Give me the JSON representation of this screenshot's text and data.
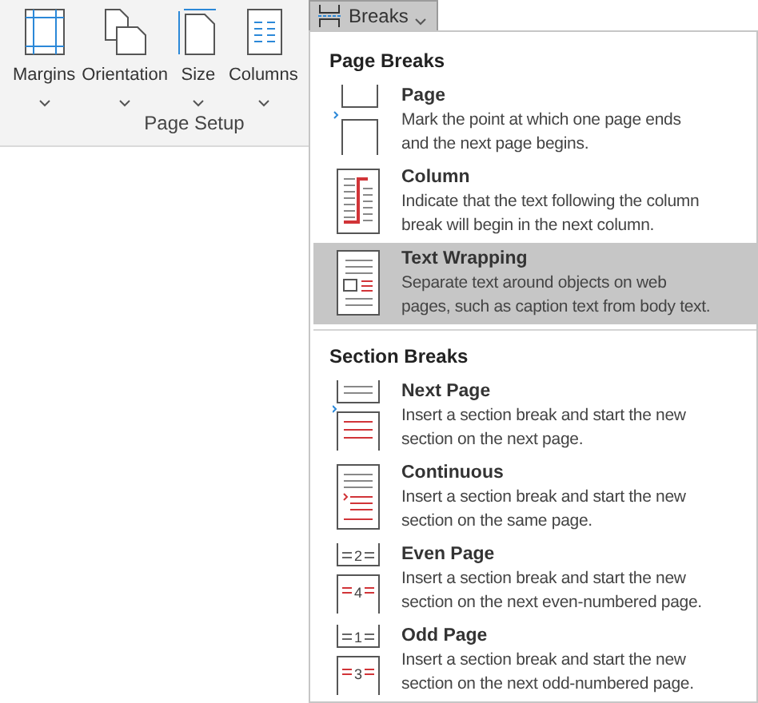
{
  "ribbon": {
    "buttons": [
      {
        "label": "Margins",
        "kind": "margins"
      },
      {
        "label": "Orientation",
        "kind": "orientation"
      },
      {
        "label": "Size",
        "kind": "size"
      },
      {
        "label": "Columns",
        "kind": "columns"
      }
    ],
    "group_label": "Page Setup",
    "breaks_button": {
      "label": "Breaks",
      "expanded": true
    }
  },
  "menu": {
    "sections": [
      {
        "heading": "Page Breaks",
        "items": [
          {
            "kind": "page",
            "title": "Page",
            "description_lines": [
              "Mark the point at which one page ends",
              "and the next page begins."
            ],
            "selected": false
          },
          {
            "kind": "column",
            "title": "Column",
            "description_lines": [
              "Indicate that the text following the column",
              "break will begin in the next column."
            ],
            "selected": false
          },
          {
            "kind": "wrapping",
            "title": "Text Wrapping",
            "description_lines": [
              "Separate text around objects on web",
              "pages, such as caption text from body text."
            ],
            "selected": true
          }
        ]
      },
      {
        "heading": "Section Breaks",
        "items": [
          {
            "kind": "next",
            "title": "Next Page",
            "description_lines": [
              "Insert a section break and start the new",
              "section on the next page."
            ],
            "selected": false
          },
          {
            "kind": "continuous",
            "title": "Continuous",
            "description_lines": [
              "Insert a section break and start the new",
              "section on the same page."
            ],
            "selected": false
          },
          {
            "kind": "numbered",
            "title": "Even Page",
            "icon_numbers": [
              "2",
              "4"
            ],
            "description_lines": [
              "Insert a section break and start the new",
              "section on the next even-numbered page."
            ],
            "selected": false
          },
          {
            "kind": "numbered",
            "title": "Odd Page",
            "icon_numbers": [
              "1",
              "3"
            ],
            "description_lines": [
              "Insert a section break and start the new",
              "section on the next odd-numbered page."
            ],
            "selected": false
          }
        ]
      }
    ]
  }
}
